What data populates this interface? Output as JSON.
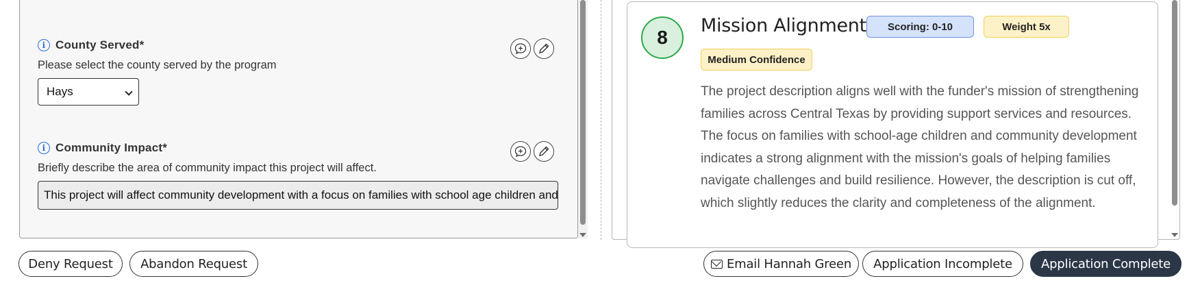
{
  "form": {
    "county": {
      "label": "County Served*",
      "description": "Please select the county served by the program",
      "selected": "Hays"
    },
    "community_impact": {
      "label": "Community Impact*",
      "description": "Briefly describe the area of community impact this project will affect.",
      "value": "This project will affect community development with a focus on families with school age children and community development"
    }
  },
  "score_card": {
    "score": "8",
    "title": "Mission Alignment",
    "scoring_badge": "Scoring: 0-10",
    "weight_badge": "Weight 5x",
    "confidence_badge": "Medium Confidence",
    "explanation": "The project description aligns well with the funder's mission of strengthening families across Central Texas by providing support services and resources. The focus on families with school-age children and community development indicates a strong alignment with the mission's goals of helping families navigate challenges and build resilience. However, the description is cut off, which slightly reduces the clarity and completeness of the alignment.",
    "colors": {
      "score_ring": "#2ea84a",
      "score_fill": "#d8f0dd",
      "blue_badge": "#d4e2fb",
      "yellow_badge": "#fdf1c7"
    }
  },
  "actions": {
    "deny": "Deny Request",
    "abandon": "Abandon Request",
    "email": "Email Hannah Green",
    "incomplete": "Application Incomplete",
    "complete": "Application Complete"
  },
  "icons": [
    "info-icon",
    "comment-plus-icon",
    "pencil-icon",
    "mail-icon",
    "chevron-down-icon"
  ]
}
